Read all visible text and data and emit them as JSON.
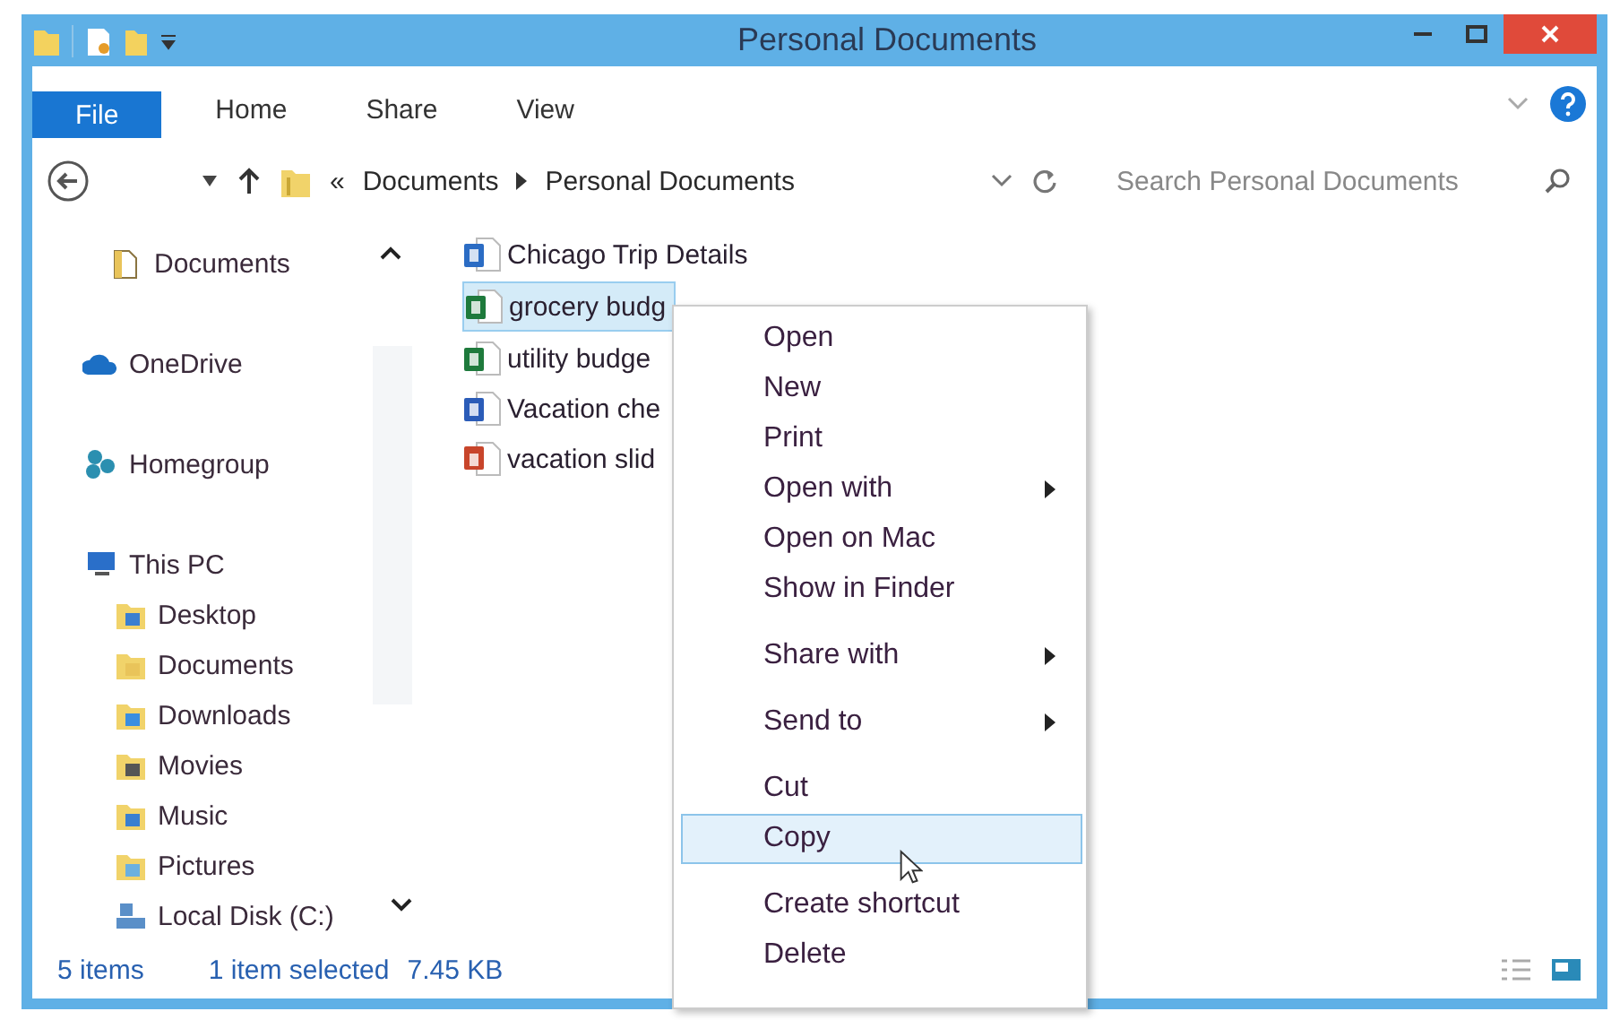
{
  "window": {
    "title": "Personal Documents"
  },
  "ribbon_tabs": [
    {
      "label": "File",
      "kind": "file"
    },
    {
      "label": "Home",
      "kind": "tab"
    },
    {
      "label": "Share",
      "kind": "tab"
    },
    {
      "label": "View",
      "kind": "tab"
    }
  ],
  "address_bar": {
    "overflow": "«",
    "breadcrumbs": [
      "Documents",
      "Personal Documents"
    ]
  },
  "search": {
    "placeholder": "Search Personal Documents"
  },
  "navigation": [
    {
      "label": "Documents",
      "kind": "documents"
    },
    {
      "label": "OneDrive",
      "kind": "onedrive"
    },
    {
      "label": "Homegroup",
      "kind": "homegroup"
    },
    {
      "label": "This PC",
      "kind": "pc",
      "children": [
        {
          "label": "Desktop",
          "kind": "desktop"
        },
        {
          "label": "Documents",
          "kind": "documents"
        },
        {
          "label": "Downloads",
          "kind": "downloads"
        },
        {
          "label": "Movies",
          "kind": "movies"
        },
        {
          "label": "Music",
          "kind": "music"
        },
        {
          "label": "Pictures",
          "kind": "pictures"
        },
        {
          "label": "Local Disk (C:)",
          "kind": "disk"
        }
      ]
    }
  ],
  "files": [
    {
      "name": "Chicago Trip Details",
      "kind": "note",
      "selected": false
    },
    {
      "name": "grocery budg",
      "kind": "excel",
      "selected": true
    },
    {
      "name": "utility budge",
      "kind": "excel",
      "selected": false
    },
    {
      "name": "Vacation che",
      "kind": "word",
      "selected": false
    },
    {
      "name": "vacation slid",
      "kind": "powerpoint",
      "selected": false
    }
  ],
  "context_menu": {
    "groups": [
      [
        {
          "label": "Open",
          "submenu": false,
          "selected": false
        },
        {
          "label": "New",
          "submenu": false,
          "selected": false
        },
        {
          "label": "Print",
          "submenu": false,
          "selected": false
        },
        {
          "label": "Open with",
          "submenu": true,
          "selected": false
        },
        {
          "label": "Open on Mac",
          "submenu": false,
          "selected": false
        },
        {
          "label": "Show in Finder",
          "submenu": false,
          "selected": false
        }
      ],
      [
        {
          "label": "Share with",
          "submenu": true,
          "selected": false
        }
      ],
      [
        {
          "label": "Send to",
          "submenu": true,
          "selected": false
        }
      ],
      [
        {
          "label": "Cut",
          "submenu": false,
          "selected": false
        },
        {
          "label": "Copy",
          "submenu": false,
          "selected": true
        }
      ],
      [
        {
          "label": "Create shortcut",
          "submenu": false,
          "selected": false
        },
        {
          "label": "Delete",
          "submenu": false,
          "selected": false
        }
      ]
    ]
  },
  "status_bar": {
    "item_count": "5 items",
    "selection": "1 item selected",
    "size": "7.45 KB"
  }
}
